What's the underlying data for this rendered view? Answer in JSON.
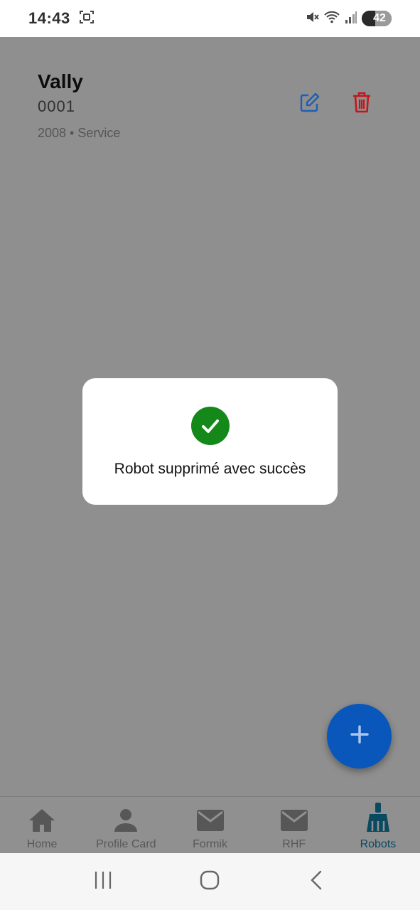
{
  "status_bar": {
    "time": "14:43",
    "battery": "42"
  },
  "robot": {
    "name": "Vally",
    "serial": "0001",
    "meta": "2008 • Service"
  },
  "modal": {
    "message": "Robot supprimé avec succès"
  },
  "tabs": [
    {
      "label": "Home",
      "icon": "home-icon",
      "active": false
    },
    {
      "label": "Profile Card",
      "icon": "person-icon",
      "active": false
    },
    {
      "label": "Formik",
      "icon": "mail-icon",
      "active": false
    },
    {
      "label": "RHF",
      "icon": "mail-icon",
      "active": false
    },
    {
      "label": "Robots",
      "icon": "robot-broom-icon",
      "active": true
    }
  ],
  "colors": {
    "overlay": "#8f8f8f",
    "fab": "#0a57bc",
    "success": "#14891a",
    "edit": "#1f5fb3",
    "delete": "#c6161c",
    "active_tab": "#0a4a60"
  }
}
